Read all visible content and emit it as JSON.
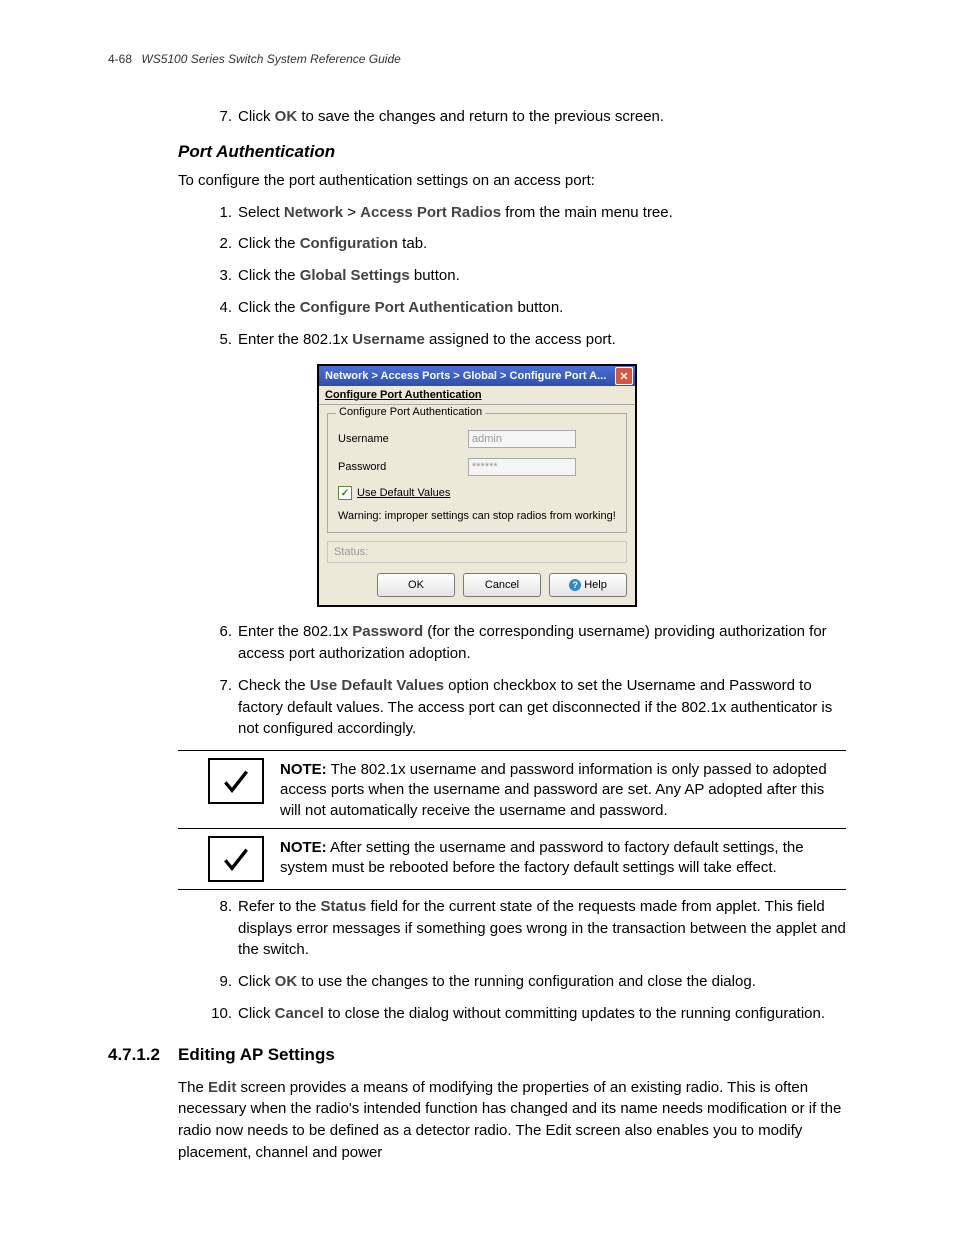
{
  "header": {
    "page": "4-68",
    "title": "WS5100 Series Switch System Reference Guide"
  },
  "top_step": {
    "num": "7.",
    "pre": "Click ",
    "bold": "OK",
    "post": " to save the changes and return to the previous screen."
  },
  "port_auth": {
    "heading": "Port Authentication",
    "intro": "To configure the port authentication settings on an access port:",
    "steps": [
      {
        "num": "1.",
        "parts": [
          "Select ",
          "Network",
          " > ",
          "Access Port Radios",
          " from the main menu tree."
        ],
        "bolds": [
          1,
          3
        ]
      },
      {
        "num": "2.",
        "parts": [
          "Click the ",
          "Configuration",
          " tab."
        ],
        "bolds": [
          1
        ]
      },
      {
        "num": "3.",
        "parts": [
          "Click the ",
          "Global Settings",
          " button."
        ],
        "bolds": [
          1
        ]
      },
      {
        "num": "4.",
        "parts": [
          "Click the ",
          "Configure Port Authentication",
          " button."
        ],
        "bolds": [
          1
        ]
      },
      {
        "num": "5.",
        "parts": [
          "Enter the 802.1x ",
          "Username",
          " assigned to the access port."
        ],
        "bolds": [
          1
        ]
      }
    ]
  },
  "dialog": {
    "title": "Network  > Access Ports  > Global  > Configure Port A...",
    "subtitle": "Configure Port Authentication",
    "legend": "Configure Port Authentication",
    "username_label": "Username",
    "username_value": "admin",
    "password_label": "Password",
    "password_value": "******",
    "checkbox_label": "Use Default Values",
    "warning": "Warning: improper settings can stop radios from working!",
    "status_label": "Status:",
    "ok": "OK",
    "cancel": "Cancel",
    "help": "Help"
  },
  "post_steps": [
    {
      "num": "6.",
      "parts": [
        "Enter the 802.1x ",
        "Password",
        " (for the corresponding username) providing authorization for access port authorization adoption."
      ],
      "bolds": [
        1
      ]
    },
    {
      "num": "7.",
      "parts": [
        "Check the ",
        "Use Default Values",
        " option checkbox to set the Username and Password to factory default values. The access port can get disconnected if the 802.1x authenticator is not configured accordingly."
      ],
      "bolds": [
        1
      ]
    }
  ],
  "notes": [
    {
      "label": "NOTE:",
      "text": " The 802.1x username and password information is only passed to adopted access ports when the username and password are set. Any AP adopted after this will not automatically receive the username and password."
    },
    {
      "label": "NOTE:",
      "text": " After setting the username and password to factory default settings, the system must be rebooted before the factory default settings will take effect."
    }
  ],
  "final_steps": [
    {
      "num": "8.",
      "parts": [
        "Refer to the ",
        "Status",
        " field for the current state of the requests made from applet. This field displays error messages if something goes wrong in the transaction between the applet and the switch."
      ],
      "bolds": [
        1
      ]
    },
    {
      "num": "9.",
      "parts": [
        "Click ",
        "OK",
        " to use the changes to the running configuration and close the dialog."
      ],
      "bolds": [
        1
      ]
    },
    {
      "num": "10.",
      "parts": [
        "Click ",
        "Cancel",
        " to close the dialog without committing updates to the running configuration."
      ],
      "bolds": [
        1
      ]
    }
  ],
  "section": {
    "num": "4.7.1.2",
    "title": "Editing AP Settings",
    "para_parts": [
      "The ",
      "Edit",
      " screen provides a means of modifying the properties of an existing radio. This is often necessary when the radio's intended function has changed and its name needs modification or if the radio now needs to be defined as a detector radio. The Edit screen also enables you to modify placement, channel and power"
    ],
    "para_bolds": [
      1
    ]
  }
}
